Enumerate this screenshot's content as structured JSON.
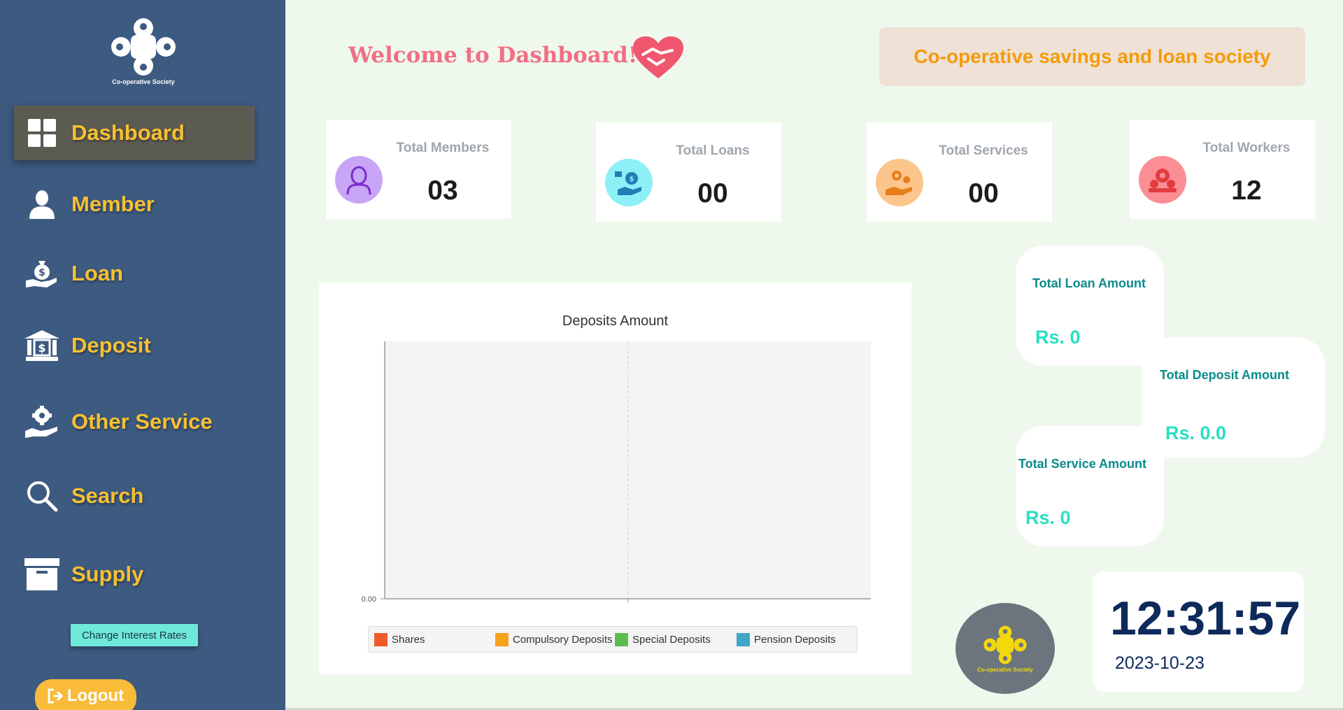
{
  "sidebar": {
    "logo_text": "Co-operative Society",
    "items": [
      {
        "label": "Dashboard",
        "icon": "grid-icon"
      },
      {
        "label": "Member",
        "icon": "user-icon"
      },
      {
        "label": "Loan",
        "icon": "money-bag-hand-icon"
      },
      {
        "label": "Deposit",
        "icon": "bank-icon"
      },
      {
        "label": "Other Service",
        "icon": "gear-hand-icon"
      },
      {
        "label": "Search",
        "icon": "search-icon"
      },
      {
        "label": "Supply",
        "icon": "archive-box-icon"
      }
    ],
    "rates_button": "Change Interest Rates",
    "logout_button": "Logout"
  },
  "header": {
    "welcome": "Welcome to Dashboard!",
    "banner": "Co-operative savings and loan society"
  },
  "stats": [
    {
      "title": "Total Members",
      "value": "03",
      "icon": "members-icon",
      "color": "#c8a6f5"
    },
    {
      "title": "Total Loans",
      "value": "00",
      "icon": "loan-hand-icon",
      "color": "#8ef0f7"
    },
    {
      "title": "Total Services",
      "value": "00",
      "icon": "service-hand-icon",
      "color": "#fcc58b"
    },
    {
      "title": "Total Workers",
      "value": "12",
      "icon": "workers-icon",
      "color": "#fb8e95"
    }
  ],
  "amounts": {
    "loan": {
      "title": "Total Loan Amount",
      "value": "Rs. 0"
    },
    "deposit": {
      "title": "Total Deposit Amount",
      "value": "Rs. 0.0"
    },
    "service": {
      "title": "Total Service Amount",
      "value": "Rs. 0"
    }
  },
  "chart_data": {
    "type": "bar",
    "title": "Deposits Amount",
    "categories": [],
    "y_tick_labels": [
      "0.00"
    ],
    "series": [
      {
        "name": "Shares",
        "color": "#f05a28",
        "values": []
      },
      {
        "name": "Compulsory Deposits",
        "color": "#f5a31a",
        "values": []
      },
      {
        "name": "Special Deposits",
        "color": "#5bbd4f",
        "values": []
      },
      {
        "name": "Pension Deposits",
        "color": "#3ea6c6",
        "values": []
      }
    ],
    "legend": "bottom",
    "grid": true
  },
  "clock": {
    "time": "12:31:57",
    "date": "2023-10-23"
  },
  "footer_logo_text": "Co-operative Society"
}
